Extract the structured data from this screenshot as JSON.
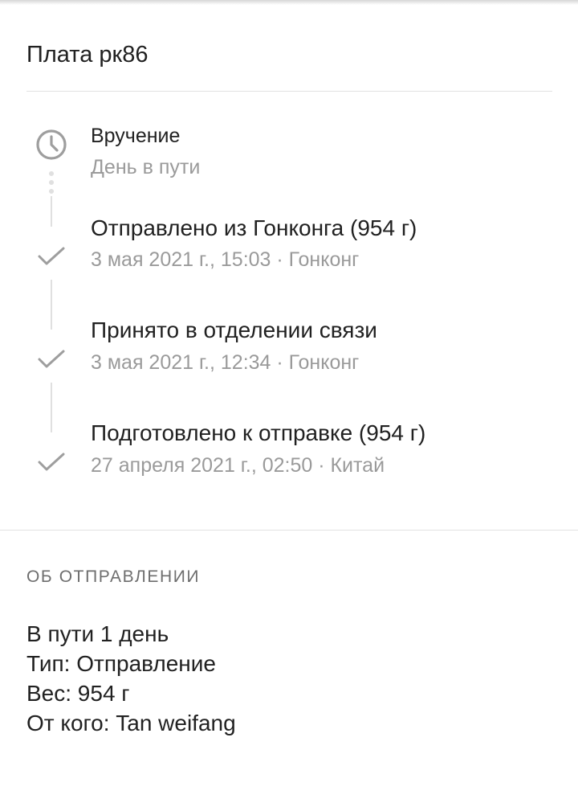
{
  "parcel": {
    "title": "Плата рк86"
  },
  "timeline": [
    {
      "title": "Вручение",
      "subtitle": "День в пути",
      "icon": "clock-icon"
    },
    {
      "title": "Отправлено из Гонконга (954 г)",
      "subtitle": "3 мая 2021 г., 15:03 · Гонконг",
      "icon": "check-icon"
    },
    {
      "title": "Принято в отделении связи",
      "subtitle": "3 мая 2021 г., 12:34 · Гонконг",
      "icon": "check-icon"
    },
    {
      "title": "Подготовлено к отправке (954 г)",
      "subtitle": "27 апреля 2021 г., 02:50 · Китай",
      "icon": "check-icon"
    }
  ],
  "about": {
    "header": "ОБ ОТПРАВЛЕНИИ",
    "lines": [
      "В пути 1 день",
      "Тип: Отправление",
      "Вес: 954 г",
      "От кого: Tan weifang"
    ]
  },
  "colors": {
    "text_primary": "#212121",
    "text_secondary": "#9a9a9a",
    "icon_gray": "#9e9e9e",
    "line_gray": "#e0e0e0"
  }
}
